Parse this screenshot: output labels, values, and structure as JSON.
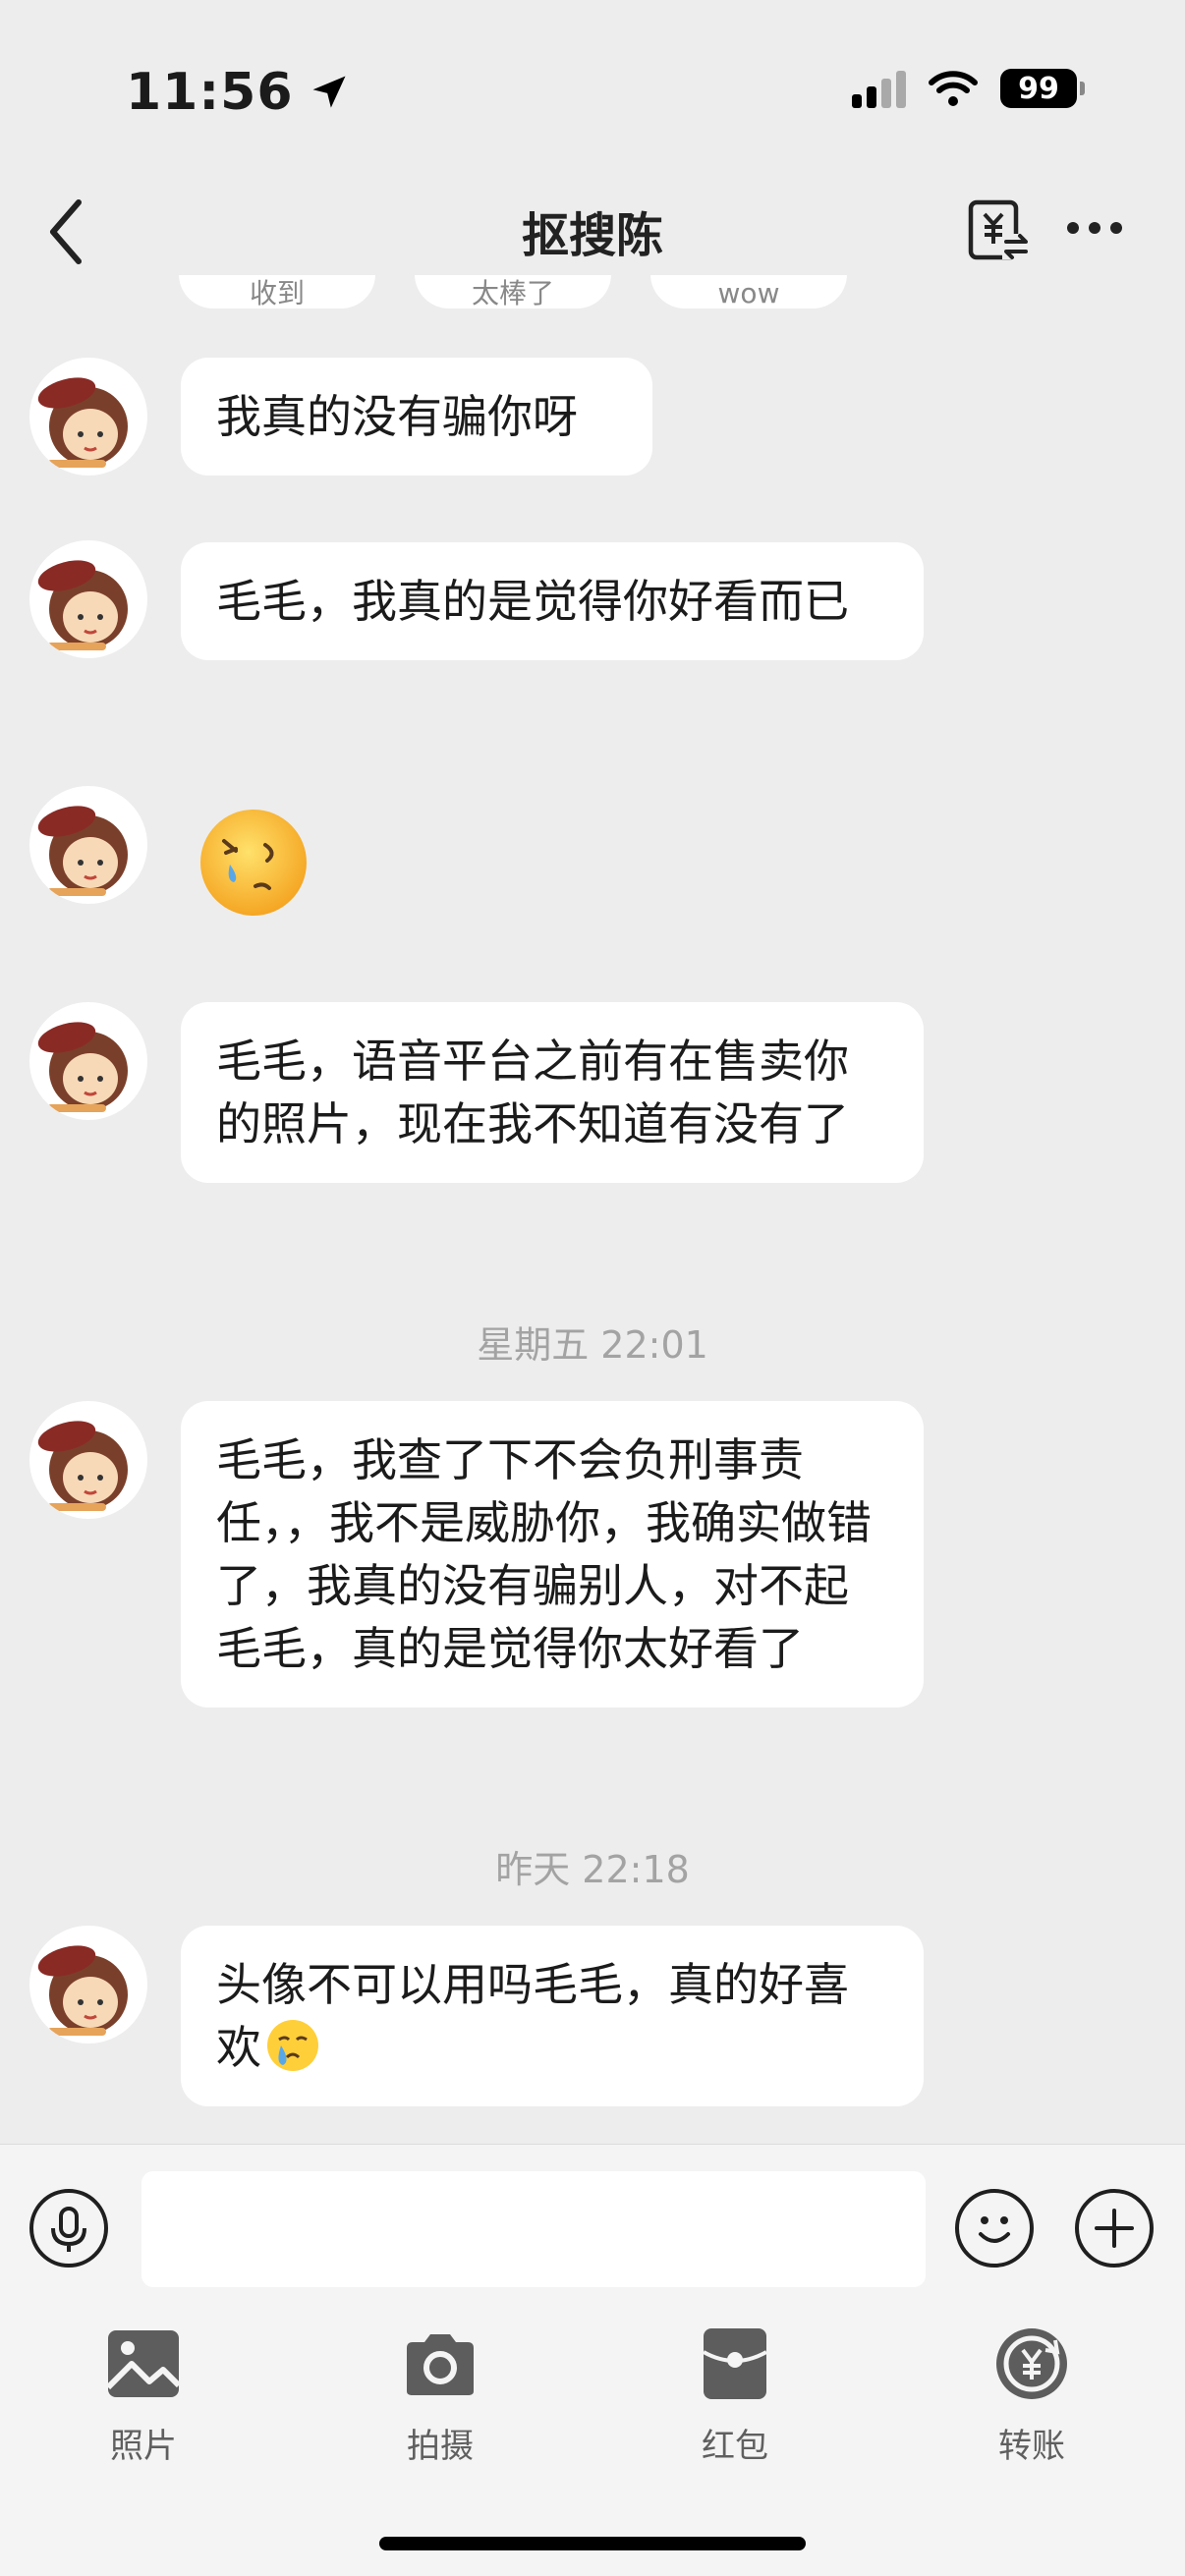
{
  "status_bar": {
    "time": "11:56",
    "battery": "99"
  },
  "header": {
    "title": "抠搜陈"
  },
  "chips": [
    "收到",
    "太棒了",
    "wow"
  ],
  "messages": [
    {
      "type": "text",
      "text": "我真的没有骗你呀"
    },
    {
      "type": "text",
      "text": "毛毛，我真的是觉得你好看而已"
    },
    {
      "type": "emoji",
      "emoji": "crying-tired-face-emoji"
    },
    {
      "type": "text",
      "text": "毛毛，语音平台之前有在售卖你的照片，现在我不知道有没有了"
    },
    {
      "type": "timestamp",
      "text": "星期五 22:01"
    },
    {
      "type": "text",
      "text": "毛毛，我查了下不会负刑事责任，，我不是威胁你，我确实做错了，我真的没有骗别人，对不起毛毛，真的是觉得你太好看了"
    },
    {
      "type": "timestamp",
      "text": "昨天 22:18"
    },
    {
      "type": "text",
      "text": "头像不可以用吗毛毛，真的好喜欢",
      "trailing_emoji": "crying-face-emoji"
    }
  ],
  "toolbar": {
    "items": [
      {
        "label": "照片",
        "icon": "photo-icon"
      },
      {
        "label": "拍摄",
        "icon": "camera-icon"
      },
      {
        "label": "红包",
        "icon": "red-packet-icon"
      },
      {
        "label": "转账",
        "icon": "transfer-icon"
      }
    ]
  }
}
